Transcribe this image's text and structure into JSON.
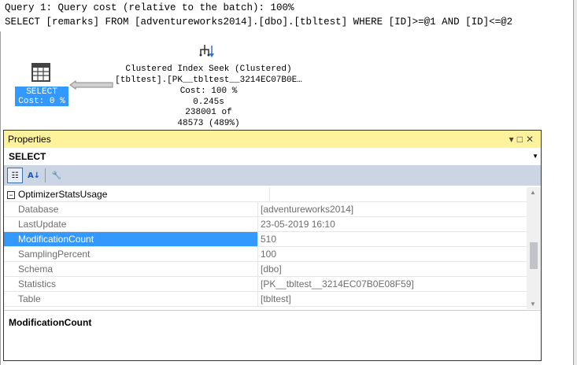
{
  "query": {
    "line1": "Query 1: Query cost (relative to the batch): 100%",
    "line2": "SELECT [remarks] FROM [adventureworks2014].[dbo].[tbltest] WHERE [ID]>=@1 AND [ID]<=@2"
  },
  "plan": {
    "select_node": {
      "label": "SELECT",
      "cost": "Cost: 0 %",
      "icon": "result-table-icon"
    },
    "seek_node": {
      "title": "Clustered Index Seek (Clustered)",
      "object": "[tbltest].[PK__tbltest__3214EC07B0E…",
      "cost": "Cost: 100 %",
      "time": "0.245s",
      "rows_actual": "238001 of",
      "rows_est": "48573 (489%)",
      "icon": "index-seek-icon"
    }
  },
  "properties": {
    "title": "Properties",
    "object": "SELECT",
    "category": "OptimizerStatsUsage",
    "rows": [
      {
        "name": "Database",
        "value": "[adventureworks2014]"
      },
      {
        "name": "LastUpdate",
        "value": "23-05-2019 16:10"
      },
      {
        "name": "ModificationCount",
        "value": "510"
      },
      {
        "name": "SamplingPercent",
        "value": "100"
      },
      {
        "name": "Schema",
        "value": "[dbo]"
      },
      {
        "name": "Statistics",
        "value": "[PK__tbltest__3214EC07B0E08F59]"
      },
      {
        "name": "Table",
        "value": "[tbltest]"
      }
    ],
    "selected": "ModificationCount",
    "description": "ModificationCount",
    "selection_color": "#3399ff",
    "title_color": "#fff29d"
  }
}
